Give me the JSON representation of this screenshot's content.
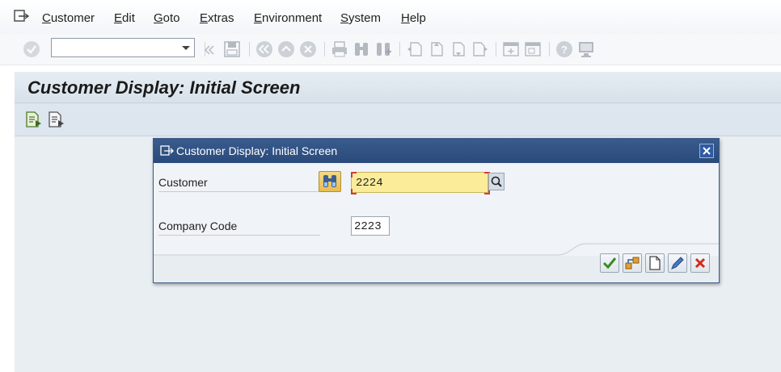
{
  "menu": {
    "items": [
      "Customer",
      "Edit",
      "Goto",
      "Extras",
      "Environment",
      "System",
      "Help"
    ]
  },
  "toolbar": {
    "command_field_value": "",
    "icons": [
      "enter-icon",
      "save-icon",
      "back-icon",
      "exit-icon",
      "cancel-icon",
      "print-icon",
      "find-icon",
      "find-next-icon",
      "first-page-icon",
      "previous-page-icon",
      "next-page-icon",
      "last-page-icon",
      "create-session-icon",
      "shortcut-icon",
      "help-icon",
      "layout-icon"
    ]
  },
  "title": "Customer Display: Initial Screen",
  "dialog": {
    "title": "Customer Display: Initial Screen",
    "customer_label": "Customer",
    "customer_value": "2224",
    "company_code_label": "Company Code",
    "company_code_value": "2223",
    "buttons": [
      "continue-icon",
      "object-tree-icon",
      "create-icon",
      "change-icon",
      "cancel-icon"
    ]
  },
  "colors": {
    "dialog_header": "#2f5080",
    "required_field": "#fbec9a",
    "title_bar": "#dde6ef"
  }
}
